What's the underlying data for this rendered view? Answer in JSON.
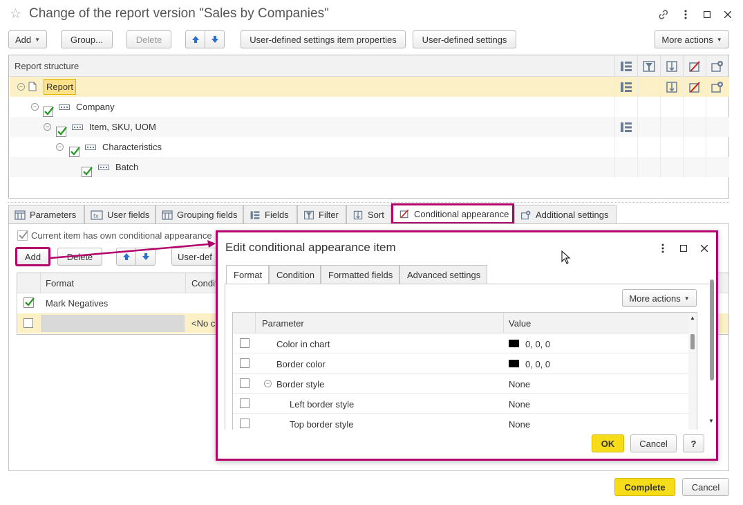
{
  "window": {
    "title": "Change of the report version \"Sales by Companies\""
  },
  "toolbar": {
    "add": "Add",
    "group": "Group...",
    "delete": "Delete",
    "item_properties": "User-defined settings item properties",
    "user_settings": "User-defined settings",
    "more_actions": "More actions"
  },
  "structure": {
    "header": "Report structure",
    "rows": [
      {
        "label": "Report"
      },
      {
        "label": "Company"
      },
      {
        "label": "Item, SKU, UOM"
      },
      {
        "label": "Characteristics"
      },
      {
        "label": "Batch"
      }
    ]
  },
  "tabs": [
    {
      "label": "Parameters"
    },
    {
      "label": "User fields"
    },
    {
      "label": "Grouping fields"
    },
    {
      "label": "Fields"
    },
    {
      "label": "Filter"
    },
    {
      "label": "Sort"
    },
    {
      "label": "Conditional appearance"
    },
    {
      "label": "Additional settings"
    }
  ],
  "ca": {
    "own_appearance": "Current item has own conditional appearance",
    "add": "Add",
    "delete": "Delete",
    "user_def": "User-def",
    "col_format": "Format",
    "col_condition": "Condit",
    "rows": [
      {
        "format": "Mark Negatives",
        "condition": ""
      },
      {
        "format": "",
        "condition": "<No c"
      }
    ]
  },
  "dialog": {
    "title": "Edit conditional appearance item",
    "tabs": [
      "Format",
      "Condition",
      "Formatted fields",
      "Advanced settings"
    ],
    "more_actions": "More actions",
    "col_parameter": "Parameter",
    "col_value": "Value",
    "rows": [
      {
        "param": "Color in chart",
        "value": "0, 0, 0",
        "swatch": "#000000"
      },
      {
        "param": "Border color",
        "value": "0, 0, 0",
        "swatch": "#000000"
      },
      {
        "param": "Border style",
        "value": "None"
      },
      {
        "param": "Left border style",
        "value": "None"
      },
      {
        "param": "Top border style",
        "value": "None"
      }
    ],
    "ok": "OK",
    "cancel": "Cancel",
    "help": "?"
  },
  "footer": {
    "complete": "Complete",
    "cancel": "Cancel"
  },
  "colors": {
    "accent": "#b3006b",
    "highlight": "#fbf0c6",
    "primary_button": "#f7dc1a",
    "check": "#2a9a2a",
    "arrow": "#2a6fd0"
  }
}
